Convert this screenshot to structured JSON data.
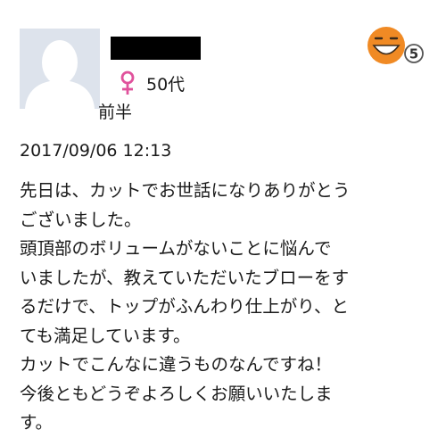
{
  "reviewer": {
    "avatar_icon": "default-user-avatar-icon",
    "name_redacted": true,
    "gender_icon": "female-icon",
    "age_group": "50代",
    "age_group_detail": "前半"
  },
  "rating": {
    "icon": "smiling-face-icon",
    "score": "5"
  },
  "review": {
    "date": "2017/09/06 12:13",
    "lines": [
      "先日は、カットでお世話になりありがとう",
      "ございました。",
      "頭頂部のボリュームがないことに悩んで",
      "いましたが、教えていただいたブローをす",
      "るだけで、トップがふんわり仕上がり、と",
      "ても満足しています。",
      "カットでこんなに違うものなんですね！",
      "今後ともどうぞよろしくお願いいたしま",
      "す。"
    ]
  },
  "colors": {
    "face_orange": "#f08a24",
    "female_pink": "#e0529c",
    "avatar_bg": "#dde3ec"
  }
}
